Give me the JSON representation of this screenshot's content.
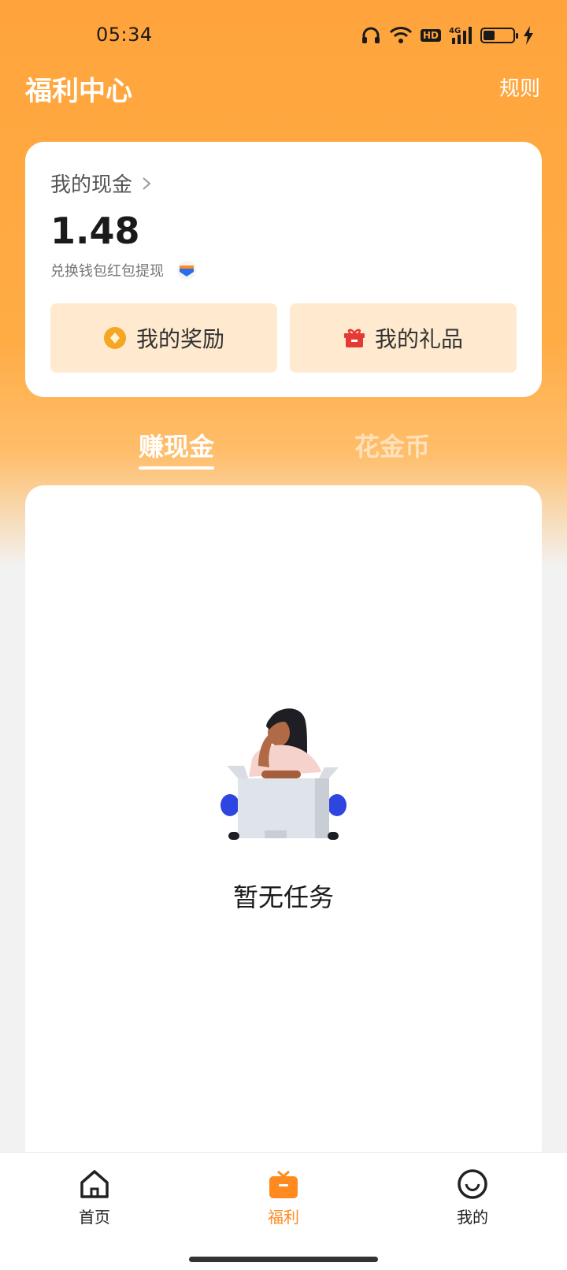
{
  "status_bar": {
    "time": "05:34",
    "icons": [
      "headphones-icon",
      "wifi-icon",
      "hd-icon",
      "signal-4g-icon",
      "battery-icon",
      "charging-icon"
    ],
    "hd_label": "HD",
    "network_label": "4G"
  },
  "header": {
    "title": "福利中心",
    "rules_label": "规则"
  },
  "cash_card": {
    "title": "我的现金",
    "amount": "1.48",
    "subtitle": "兑换钱包红包提现",
    "rewards_label": "我的奖励",
    "gifts_label": "我的礼品"
  },
  "tabs": [
    {
      "label": "赚现金",
      "active": true
    },
    {
      "label": "花金币",
      "active": false
    }
  ],
  "task_panel": {
    "empty_text": "暂无任务"
  },
  "bottom_nav": {
    "items": [
      {
        "label": "首页",
        "icon": "home-icon",
        "active": false
      },
      {
        "label": "福利",
        "icon": "tv-gift-icon",
        "active": true
      },
      {
        "label": "我的",
        "icon": "smile-profile-icon",
        "active": false
      }
    ]
  },
  "colors": {
    "accent": "#ffa43c",
    "active_nav": "#ff8a1f",
    "button_bg": "#ffeacf",
    "gift_red": "#e53935",
    "reward_gold": "#f5a623"
  }
}
